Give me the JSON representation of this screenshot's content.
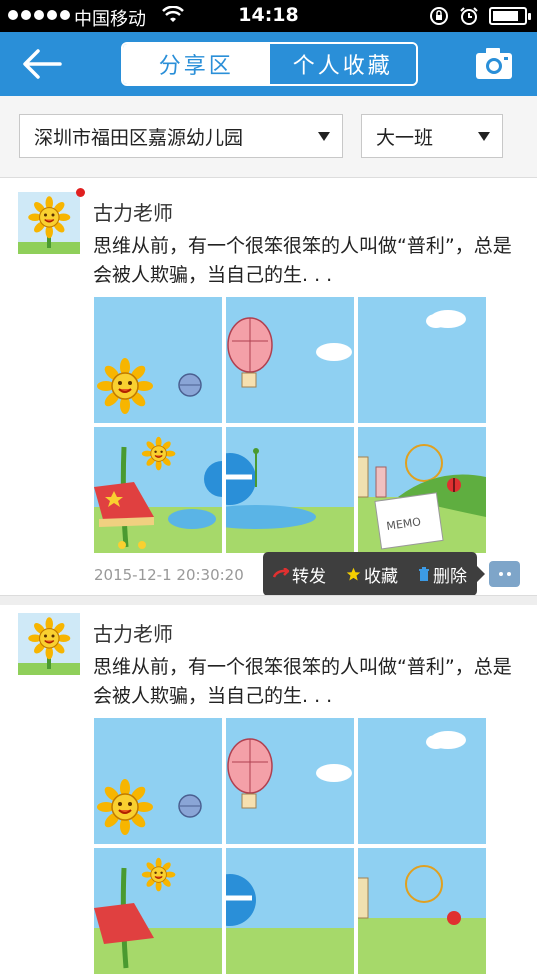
{
  "status_bar": {
    "carrier": "中国移动",
    "time": "14:18",
    "battery_level": 0.82
  },
  "nav": {
    "tabs": [
      {
        "label": "分享区",
        "active": true
      },
      {
        "label": "个人收藏",
        "active": false
      }
    ],
    "accent": "#2a8fd8"
  },
  "filters": {
    "school": "深圳市福田区嘉源幼儿园",
    "class": "大一班"
  },
  "posts": [
    {
      "author": "古力老师",
      "text": "思维从前，有一个很笨很笨的人叫做“普利”，总是会被人欺骗，当自己的生. . .",
      "timestamp": "2015-12-1 20:30:20",
      "unread": true
    },
    {
      "author": "古力老师",
      "text": "思维从前，有一个很笨很笨的人叫做“普利”，总是会被人欺骗，当自己的生. . .",
      "unread": false
    }
  ],
  "actions": {
    "forward": "转发",
    "favorite": "收藏",
    "delete": "删除"
  },
  "icons": {
    "back": "back-arrow-icon",
    "camera": "camera-icon",
    "forward": "forward-icon",
    "favorite": "star-icon",
    "delete": "trash-icon",
    "more": "more-dots-icon"
  }
}
